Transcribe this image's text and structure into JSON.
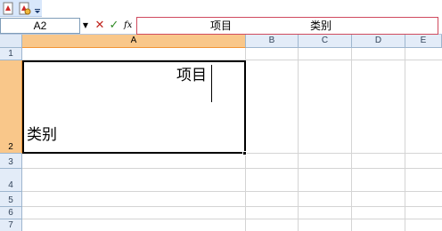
{
  "formula_bar": {
    "name_box": "A2",
    "content_line1": "项目",
    "content_line2": "类别"
  },
  "columns": [
    "A",
    "B",
    "C",
    "D",
    "E"
  ],
  "rows": [
    "1",
    "2",
    "3",
    "4",
    "5",
    "6",
    "7"
  ],
  "active_cell": {
    "ref": "A2",
    "line1": "项目",
    "line2": "类别"
  },
  "colors": {
    "selected_header": "#f9c78a",
    "header": "#e3ecf8",
    "formula_border": "#d04a5e",
    "cancel": "#c0241d",
    "enter": "#2f8a25"
  }
}
